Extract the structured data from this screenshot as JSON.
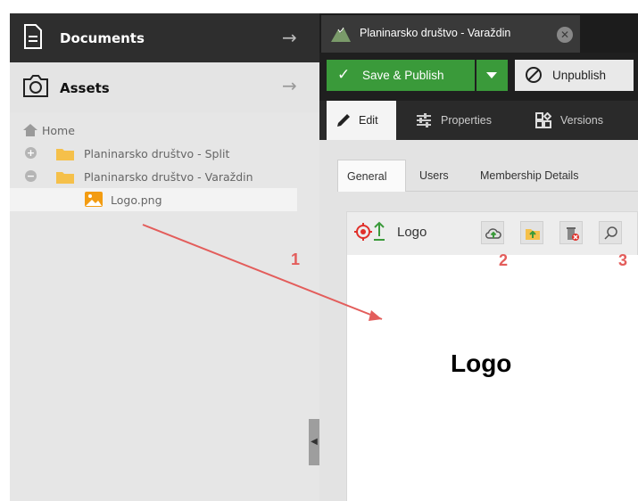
{
  "sidebar": {
    "documents_label": "Documents",
    "assets_label": "Assets",
    "tree": [
      {
        "label": "Home",
        "kind": "home"
      },
      {
        "label": "Planinarsko društvo - Split",
        "kind": "folder",
        "toggle": "+"
      },
      {
        "label": "Planinarsko društvo - Varaždin",
        "kind": "folder",
        "toggle": "−"
      },
      {
        "label": "Logo.png",
        "kind": "image",
        "selected": true
      }
    ],
    "collapse_glyph": "◀"
  },
  "editor": {
    "tab_title": "Planinarsko društvo - Varaždin",
    "save_publish_label": "Save & Publish",
    "unpublish_label": "Unpublish",
    "subtabs": {
      "edit": "Edit",
      "properties": "Properties",
      "versions": "Versions"
    },
    "inner_tabs": {
      "general": "General",
      "users": "Users",
      "membership": "Membership Details"
    },
    "field": {
      "title": "Logo",
      "preview_text": "Logo"
    }
  },
  "annotations": {
    "one": "1",
    "two": "2",
    "three": "3"
  },
  "colors": {
    "accent_green": "#3a9a3a",
    "annotation_red": "#e35d5b",
    "folder_yellow": "#f5c04a",
    "image_orange": "#f39c12"
  }
}
